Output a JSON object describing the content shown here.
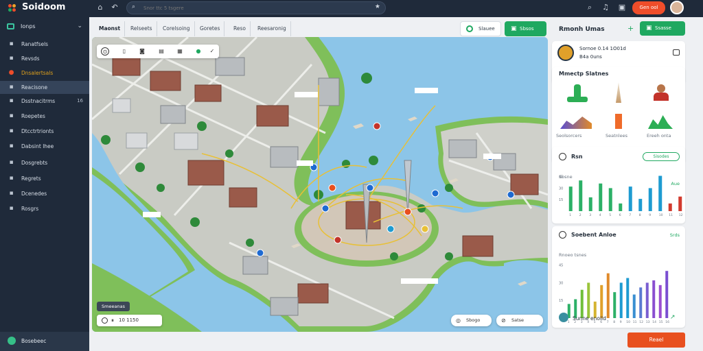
{
  "app": {
    "name": "Soidoom",
    "accent": "#1fa860",
    "cta_color": "#ef4d2a"
  },
  "topbar": {
    "search_placeholder": "Snor ttc 5 tsgere",
    "cta_label": "Gen ool",
    "icons": [
      "home-icon",
      "back-icon",
      "search-icon",
      "star-icon",
      "bell-icon",
      "share-icon",
      "settings-icon"
    ]
  },
  "sidebar": {
    "header": "Ionps",
    "items": [
      {
        "label": "Ranatfsels",
        "icon": "layers-icon",
        "active": false,
        "count": ""
      },
      {
        "label": "Revsds",
        "icon": "list-icon",
        "active": false,
        "count": ""
      },
      {
        "label": "Dnsalertsals",
        "icon": "alert-icon",
        "active": false,
        "count": "",
        "highlight": "#e0a11b"
      },
      {
        "label": "Reacisone",
        "icon": "grid-icon",
        "active": true,
        "count": ""
      },
      {
        "label": "Dsstnacitrms",
        "icon": "pin-icon",
        "active": false,
        "count": "16"
      },
      {
        "label": "Roepetes",
        "icon": "file-icon",
        "active": false,
        "count": ""
      },
      {
        "label": "Dtcctrtrionts",
        "icon": "chart-icon",
        "active": false,
        "count": ""
      },
      {
        "label": "Dabsint lhee",
        "icon": "shield-icon",
        "active": false,
        "count": ""
      },
      {
        "label": "Dosgrebts",
        "icon": "folder-icon",
        "active": false,
        "count": ""
      },
      {
        "label": "Regrets",
        "icon": "tool-icon",
        "active": false,
        "count": ""
      },
      {
        "label": "Dcenedes",
        "icon": "user-icon",
        "active": false,
        "count": ""
      },
      {
        "label": "Rosgrs",
        "icon": "gear-icon",
        "active": false,
        "count": ""
      }
    ],
    "footer": "Bosebeec"
  },
  "tabs": [
    "Maonst",
    "Relseets",
    "Corelsoing",
    "Goretes",
    "Reso",
    "Reesaronig"
  ],
  "toolbar": {
    "outline_label": "Slauee",
    "green_label": "Sbsos"
  },
  "map": {
    "scale_badge": "Smeeanas",
    "play_label": "10 1150",
    "btn_a": "Sbogo",
    "btn_b": "Satse",
    "tools": [
      "compass-icon",
      "file-icon",
      "camera-icon",
      "layers-icon",
      "grid-icon",
      "globe-icon",
      "check-icon"
    ]
  },
  "right_panel": {
    "title": "Rmonh Umas",
    "green_btn": "Ssasse",
    "profile": {
      "line1": "Sornoe 0.14 1O01d",
      "line2": "B4a 0uns"
    },
    "highlights": {
      "title": "Mmectp Slatnes",
      "captions": [
        "Seolsorcers",
        "Seatnlees",
        "Ereeh onta"
      ]
    },
    "chart1": {
      "title": "Rsn",
      "chip": "Sisodes",
      "ylabel": "Sosne",
      "legend": "Aue"
    },
    "chart2": {
      "title": "Soebent Anloe",
      "tag": "Srds",
      "subtitle": "Rnoeo tsnes"
    },
    "footer_label": "Sunne enoild",
    "footer_btn": "Reael"
  },
  "chart_data": [
    {
      "type": "bar",
      "title": "Rsn",
      "categories": [
        "1",
        "2",
        "3",
        "4",
        "5",
        "6",
        "7",
        "8",
        "9",
        "10",
        "11",
        "12"
      ],
      "series": [
        {
          "values": [
            32,
            40,
            18,
            36,
            30,
            10,
            32,
            16,
            30,
            46,
            10,
            19
          ]
        }
      ],
      "ylim": [
        0,
        50
      ],
      "colors": [
        "#2cb067",
        "#2cb067",
        "#2cb067",
        "#2cb067",
        "#2cb067",
        "#2cb067",
        "#1e9bd1",
        "#1e9bd1",
        "#1e9bd1",
        "#1e9bd1",
        "#d23a2e",
        "#d23a2e"
      ]
    },
    {
      "type": "bar",
      "title": "Soebent Anloe",
      "categories": [
        "1",
        "2",
        "3",
        "4",
        "5",
        "6",
        "7",
        "8",
        "9",
        "10",
        "11",
        "12",
        "13",
        "14",
        "15",
        "16"
      ],
      "series": [
        {
          "values": [
            12,
            16,
            24,
            30,
            14,
            28,
            38,
            22,
            30,
            34,
            20,
            26,
            30,
            32,
            28,
            40
          ]
        }
      ],
      "ylim": [
        0,
        50
      ],
      "colors": [
        "#2cb067",
        "#2cb067",
        "#6fbf3a",
        "#9ac43a",
        "#d4b430",
        "#e0a02a",
        "#e08a2a",
        "#2cb067",
        "#1e9bd1",
        "#1e9bd1",
        "#3a8fd1",
        "#5a7ad1",
        "#7a5ed1",
        "#8a4ed1",
        "#9a4ed1",
        "#7a4ed1"
      ]
    }
  ]
}
